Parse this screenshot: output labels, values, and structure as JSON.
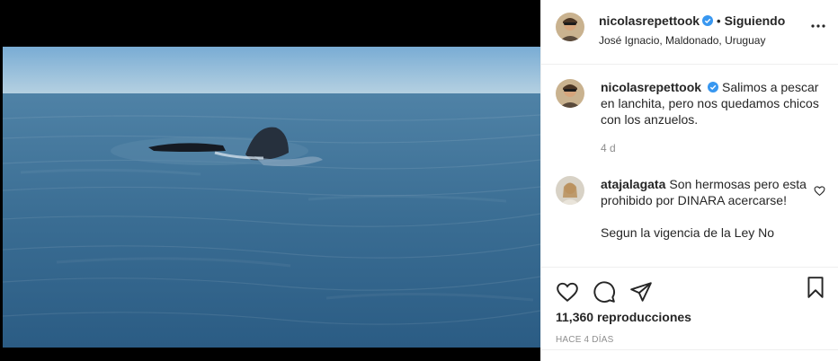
{
  "post": {
    "author": "nicolasrepettook",
    "follow_status": "Siguiendo",
    "location": "José Ignacio, Maldonado, Uruguay"
  },
  "caption": {
    "author": "nicolasrepettook",
    "text": "Salimos a pescar en lanchita, pero nos quedamos chicos con los anzuelos.",
    "time": "4 d"
  },
  "comments": [
    {
      "author": "atajalagata",
      "text_line1": "Son hermosas pero esta prohibido por DINARA acercarse!",
      "text_line2": "Segun la vigencia de la Ley No"
    }
  ],
  "stats": {
    "views": "11,360 reproducciones",
    "posted": "HACE 4 DÍAS"
  },
  "icons": [
    "heart-icon",
    "comment-icon",
    "share-icon",
    "bookmark-icon",
    "more-options-icon",
    "verified-badge-icon"
  ],
  "colors": {
    "verified": "#3897f0",
    "text": "#262626",
    "muted": "#8e8e8e"
  }
}
